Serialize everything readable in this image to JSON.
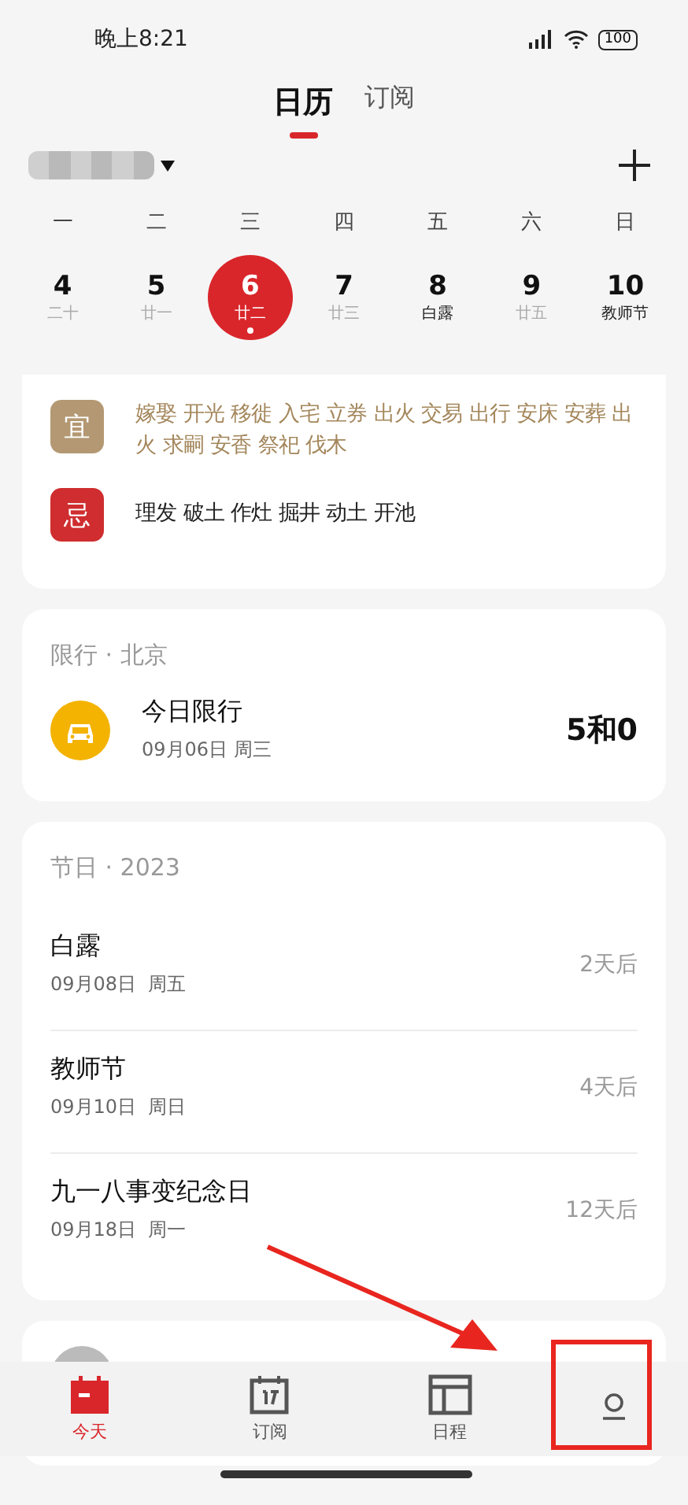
{
  "status_bar": {
    "time": "晚上8:21",
    "battery": "100"
  },
  "tabs": [
    {
      "label": "日历",
      "selected": true
    },
    {
      "label": "订阅",
      "selected": false
    }
  ],
  "weekdays": [
    "一",
    "二",
    "三",
    "四",
    "五",
    "六",
    "日"
  ],
  "days": [
    {
      "date": "4",
      "sub": "二十",
      "selected": false,
      "festival": false,
      "event": false
    },
    {
      "date": "5",
      "sub": "廿一",
      "selected": false,
      "festival": false,
      "event": false
    },
    {
      "date": "6",
      "sub": "廿二",
      "selected": true,
      "festival": false,
      "event": true
    },
    {
      "date": "7",
      "sub": "廿三",
      "selected": false,
      "festival": false,
      "event": false
    },
    {
      "date": "8",
      "sub": "白露",
      "selected": false,
      "festival": true,
      "event": false
    },
    {
      "date": "9",
      "sub": "廿五",
      "selected": false,
      "festival": false,
      "event": false
    },
    {
      "date": "10",
      "sub": "教师节",
      "selected": false,
      "festival": true,
      "event": false
    }
  ],
  "almanac": [
    {
      "kind": "good",
      "badge": "宜",
      "text": "嫁娶 开光 移徙 入宅 立券 出火 交易 出行 安床 安葬 出火 求嗣 安香 祭祀 伐木"
    },
    {
      "kind": "bad",
      "badge": "忌",
      "text": "理发 破土 作灶 掘井 动土 开池"
    }
  ],
  "traffic": {
    "header": "限行 · 北京",
    "title": "今日限行",
    "date": "09月06日 周三",
    "numbers": "5和0"
  },
  "holidays": {
    "header": "节日 · 2023",
    "items": [
      {
        "name": "白露",
        "date": "09月08日  周五",
        "countdown": "2天后"
      },
      {
        "name": "教师节",
        "date": "09月10日  周日",
        "countdown": "4天后"
      },
      {
        "name": "九一八事变纪念日",
        "date": "09月18日  周一",
        "countdown": "12天后"
      }
    ]
  },
  "nav": [
    {
      "kind": "today",
      "label": "今天",
      "selected": true
    },
    {
      "kind": "subscribe",
      "label": "订阅",
      "selected": false
    },
    {
      "kind": "schedule",
      "label": "日程",
      "selected": false
    },
    {
      "kind": "me",
      "selected": false
    }
  ]
}
